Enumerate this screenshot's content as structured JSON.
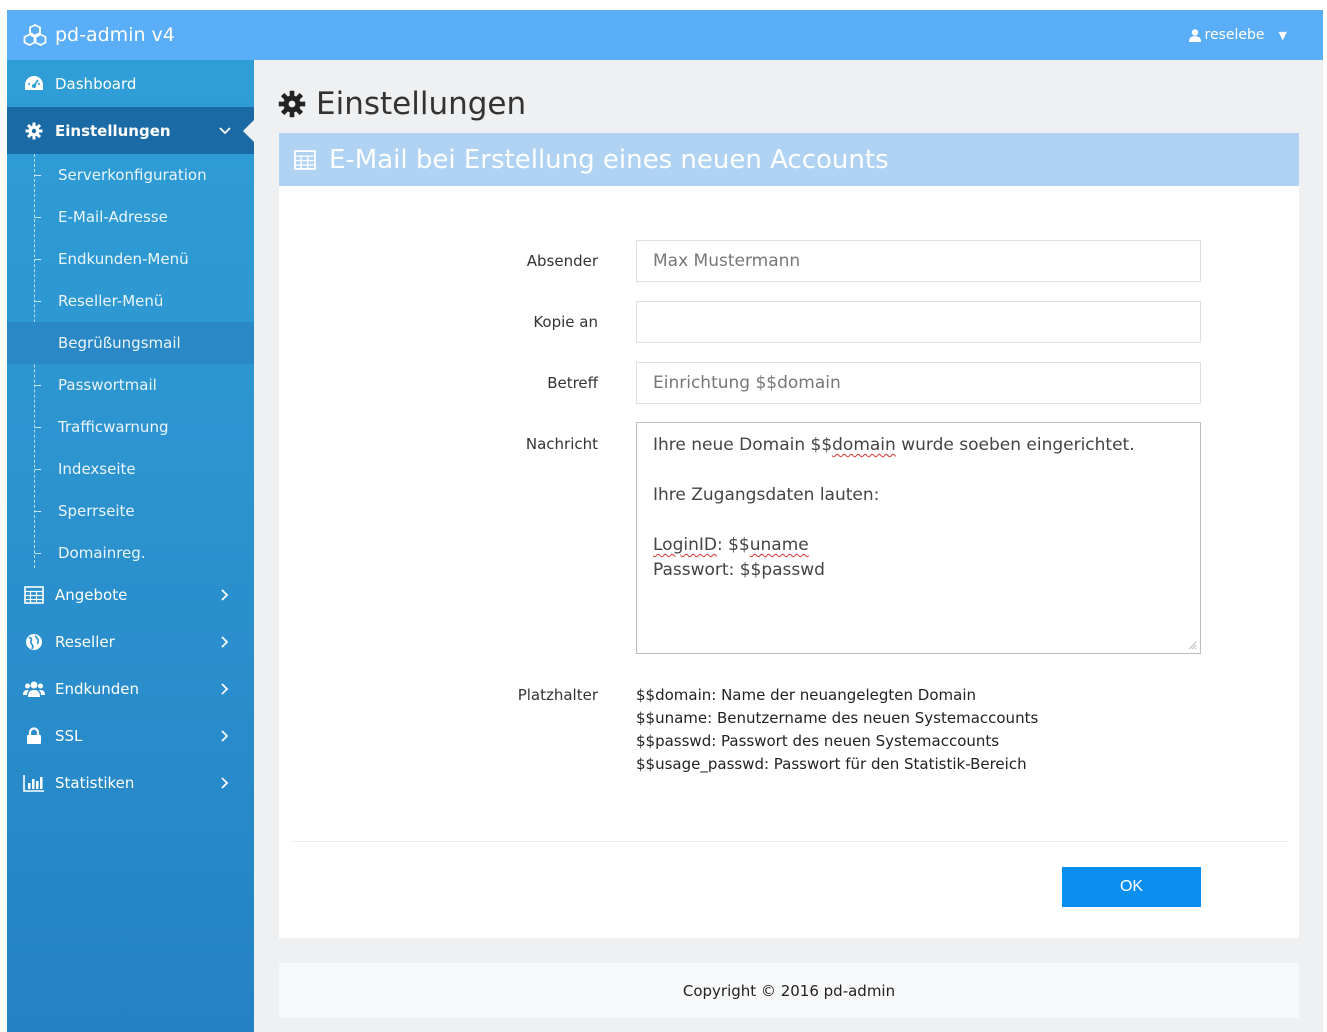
{
  "app": {
    "title": "pd-admin v4",
    "user": "reselebe"
  },
  "sidebar": {
    "items": [
      {
        "label": "Dashboard",
        "icon": "dashboard-icon"
      },
      {
        "label": "Einstellungen",
        "icon": "gear-icon",
        "expanded": true
      },
      {
        "label": "Angebote",
        "icon": "table-icon"
      },
      {
        "label": "Reseller",
        "icon": "globe-icon"
      },
      {
        "label": "Endkunden",
        "icon": "users-icon"
      },
      {
        "label": "SSL",
        "icon": "lock-icon"
      },
      {
        "label": "Statistiken",
        "icon": "bar-chart-icon"
      }
    ],
    "subitems": [
      {
        "label": "Serverkonfiguration"
      },
      {
        "label": "E-Mail-Adresse"
      },
      {
        "label": "Endkunden-Menü"
      },
      {
        "label": "Reseller-Menü"
      },
      {
        "label": "Begrüßungsmail",
        "current": true
      },
      {
        "label": "Passwortmail"
      },
      {
        "label": "Trafficwarnung"
      },
      {
        "label": "Indexseite"
      },
      {
        "label": "Sperrseite"
      },
      {
        "label": "Domainreg."
      }
    ]
  },
  "page": {
    "title": "Einstellungen"
  },
  "panel": {
    "title": "E-Mail bei Erstellung eines neuen Accounts"
  },
  "form": {
    "sender_label": "Absender",
    "sender_placeholder": "Max Mustermann",
    "cc_label": "Kopie an",
    "cc_value": "",
    "subject_label": "Betreff",
    "subject_placeholder": "Einrichtung $$domain",
    "message_label": "Nachricht",
    "message": {
      "line1_pre": "Ihre neue Domain $$",
      "line1_word": "domain",
      "line1_post": " wurde soeben eingerichtet.",
      "line2": "",
      "line3": "Ihre Zugangsdaten lauten:",
      "line4": "",
      "line5_word": "LoginID",
      "line5_mid": ": $$",
      "line5_word2": "uname",
      "line6": "Passwort: $$passwd"
    },
    "placeholders_label": "Platzhalter",
    "placeholders": [
      "$$domain: Name der neuangelegten Domain",
      "$$uname: Benutzername des neuen Systemaccounts",
      "$$passwd: Passwort des neuen Systemaccounts",
      "$$usage_passwd: Passwort für den Statistik-Bereich"
    ],
    "ok_label": "OK"
  },
  "footer": {
    "text": "Copyright © 2016 pd-admin"
  },
  "colors": {
    "topbar": "#5aaef7",
    "sidebar": "#2a8fcc",
    "sidebar_active": "#1a6aa5",
    "panel_header": "#b0d3f3",
    "primary_button": "#0a8ef0"
  }
}
